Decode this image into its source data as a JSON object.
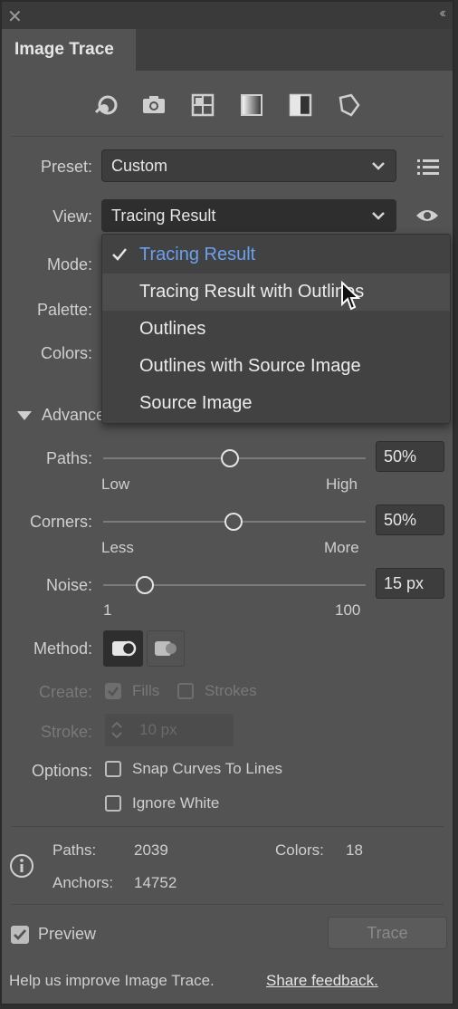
{
  "window": {
    "close_glyph": "✕",
    "collapse_glyph": "‹‹"
  },
  "tab": {
    "label": "Image Trace"
  },
  "presets_toolbar": [
    "auto-color-preset-icon",
    "high-color-preset-icon",
    "low-color-preset-icon",
    "grayscale-preset-icon",
    "black-and-white-preset-icon",
    "outline-preset-icon"
  ],
  "preset": {
    "label": "Preset:",
    "value": "Custom"
  },
  "view": {
    "label": "View:",
    "value": "Tracing Result"
  },
  "mode": {
    "label": "Mode:"
  },
  "palette": {
    "label": "Palette:"
  },
  "colors": {
    "label": "Colors:"
  },
  "view_menu": {
    "items": [
      "Tracing Result",
      "Tracing Result with Outlines",
      "Outlines",
      "Outlines with Source Image",
      "Source Image"
    ],
    "selected_index": 0,
    "hover_index": 1
  },
  "advanced": {
    "label": "Advanced"
  },
  "paths": {
    "label": "Paths:",
    "value": "50%",
    "fraction": 0.5,
    "low": "Low",
    "high": "High"
  },
  "corners": {
    "label": "Corners:",
    "value": "50%",
    "fraction": 0.5,
    "low": "Less",
    "high": "More"
  },
  "noise": {
    "label": "Noise:",
    "value": "15 px",
    "fraction": 0.15,
    "low": "1",
    "high": "100"
  },
  "method": {
    "label": "Method:"
  },
  "create": {
    "label": "Create:",
    "fills": "Fills",
    "strokes": "Strokes",
    "fills_checked": true,
    "strokes_checked": false
  },
  "stroke": {
    "label": "Stroke:",
    "value": "10 px"
  },
  "options": {
    "label": "Options:",
    "snap": "Snap Curves To Lines",
    "ignore_white": "Ignore White"
  },
  "stats": {
    "paths_label": "Paths:",
    "paths_value": "2039",
    "colors_label": "Colors:",
    "colors_value": "18",
    "anchors_label": "Anchors:",
    "anchors_value": "14752"
  },
  "preview": {
    "label": "Preview",
    "checked": true
  },
  "trace_button": {
    "label": "Trace"
  },
  "footer": {
    "text": "Help us improve Image Trace.",
    "link": "Share feedback."
  },
  "colors_theme": {
    "panel": "#535353",
    "selected_item": "#6aa1ee"
  }
}
